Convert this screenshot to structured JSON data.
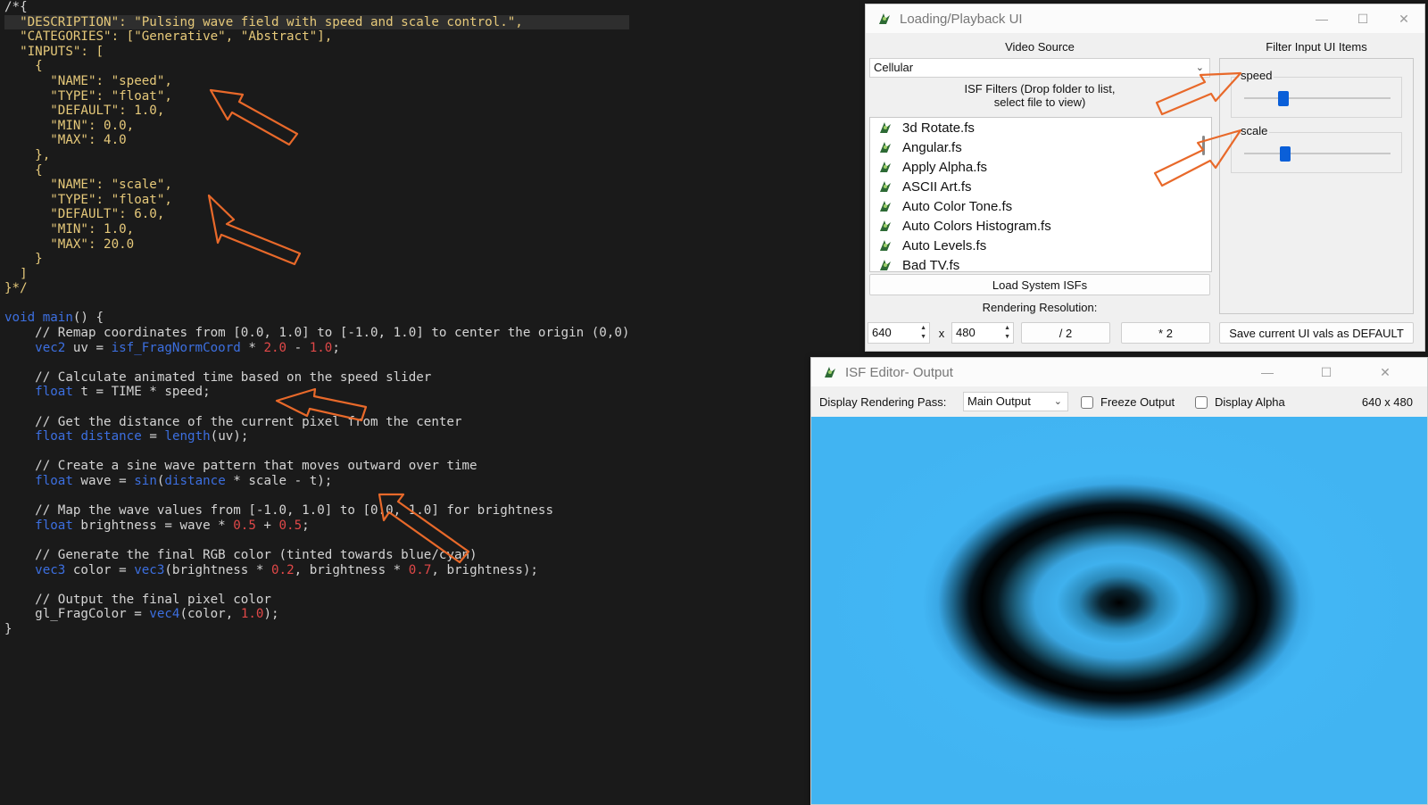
{
  "editor": {
    "lines": [
      [
        {
          "t": "/*{",
          "c": "c-txt"
        }
      ],
      [
        {
          "t": "  \"DESCRIPTION\": \"Pulsing wave field with speed and scale control.\",",
          "c": "c-meta"
        }
      ],
      [
        {
          "t": "  \"CATEGORIES\": [\"Generative\", \"Abstract\"],",
          "c": "c-meta"
        }
      ],
      [
        {
          "t": "  \"INPUTS\": [",
          "c": "c-meta"
        }
      ],
      [
        {
          "t": "    {",
          "c": "c-meta"
        }
      ],
      [
        {
          "t": "      \"NAME\": \"speed\",",
          "c": "c-meta"
        }
      ],
      [
        {
          "t": "      \"TYPE\": \"float\",",
          "c": "c-meta"
        }
      ],
      [
        {
          "t": "      \"DEFAULT\": 1.0,",
          "c": "c-meta"
        }
      ],
      [
        {
          "t": "      \"MIN\": 0.0,",
          "c": "c-meta"
        }
      ],
      [
        {
          "t": "      \"MAX\": 4.0",
          "c": "c-meta"
        }
      ],
      [
        {
          "t": "    },",
          "c": "c-meta"
        }
      ],
      [
        {
          "t": "    {",
          "c": "c-meta"
        }
      ],
      [
        {
          "t": "      \"NAME\": \"scale\",",
          "c": "c-meta"
        }
      ],
      [
        {
          "t": "      \"TYPE\": \"float\",",
          "c": "c-meta"
        }
      ],
      [
        {
          "t": "      \"DEFAULT\": 6.0,",
          "c": "c-meta"
        }
      ],
      [
        {
          "t": "      \"MIN\": 1.0,",
          "c": "c-meta"
        }
      ],
      [
        {
          "t": "      \"MAX\": 20.0",
          "c": "c-meta"
        }
      ],
      [
        {
          "t": "    }",
          "c": "c-meta"
        }
      ],
      [
        {
          "t": "  ]",
          "c": "c-meta"
        }
      ],
      [
        {
          "t": "}*/",
          "c": "c-meta"
        }
      ],
      [
        {
          "t": "",
          "c": "c-txt"
        }
      ],
      [
        {
          "t": "void",
          "c": "c-kw"
        },
        {
          "t": " ",
          "c": "c-txt"
        },
        {
          "t": "main",
          "c": "c-fn"
        },
        {
          "t": "() {",
          "c": "c-txt"
        }
      ],
      [
        {
          "t": "    // Remap coordinates from [0.0, 1.0] to [-1.0, 1.0] to center the origin (0,0)",
          "c": "c-com"
        }
      ],
      [
        {
          "t": "    ",
          "c": "c-txt"
        },
        {
          "t": "vec2",
          "c": "c-kw"
        },
        {
          "t": " uv = ",
          "c": "c-txt"
        },
        {
          "t": "isf_FragNormCoord",
          "c": "c-fn"
        },
        {
          "t": " * ",
          "c": "c-txt"
        },
        {
          "t": "2.0",
          "c": "c-num"
        },
        {
          "t": " - ",
          "c": "c-txt"
        },
        {
          "t": "1.0",
          "c": "c-num"
        },
        {
          "t": ";",
          "c": "c-txt"
        }
      ],
      [
        {
          "t": "",
          "c": "c-txt"
        }
      ],
      [
        {
          "t": "    // Calculate animated time based on the speed slider",
          "c": "c-com"
        }
      ],
      [
        {
          "t": "    ",
          "c": "c-txt"
        },
        {
          "t": "float",
          "c": "c-kw"
        },
        {
          "t": " t = TIME * speed;",
          "c": "c-txt"
        }
      ],
      [
        {
          "t": "",
          "c": "c-txt"
        }
      ],
      [
        {
          "t": "    // Get the distance of the current pixel from the center",
          "c": "c-com"
        }
      ],
      [
        {
          "t": "    ",
          "c": "c-txt"
        },
        {
          "t": "float",
          "c": "c-kw"
        },
        {
          "t": " ",
          "c": "c-txt"
        },
        {
          "t": "distance",
          "c": "c-fn"
        },
        {
          "t": " = ",
          "c": "c-txt"
        },
        {
          "t": "length",
          "c": "c-fn"
        },
        {
          "t": "(uv);",
          "c": "c-txt"
        }
      ],
      [
        {
          "t": "",
          "c": "c-txt"
        }
      ],
      [
        {
          "t": "    // Create a sine wave pattern that moves outward over time",
          "c": "c-com"
        }
      ],
      [
        {
          "t": "    ",
          "c": "c-txt"
        },
        {
          "t": "float",
          "c": "c-kw"
        },
        {
          "t": " wave = ",
          "c": "c-txt"
        },
        {
          "t": "sin",
          "c": "c-fn"
        },
        {
          "t": "(",
          "c": "c-txt"
        },
        {
          "t": "distance",
          "c": "c-fn"
        },
        {
          "t": " * scale - t);",
          "c": "c-txt"
        }
      ],
      [
        {
          "t": "",
          "c": "c-txt"
        }
      ],
      [
        {
          "t": "    // Map the wave values from [-1.0, 1.0] to [0.0, 1.0] for brightness",
          "c": "c-com"
        }
      ],
      [
        {
          "t": "    ",
          "c": "c-txt"
        },
        {
          "t": "float",
          "c": "c-kw"
        },
        {
          "t": " brightness = wave * ",
          "c": "c-txt"
        },
        {
          "t": "0.5",
          "c": "c-num"
        },
        {
          "t": " + ",
          "c": "c-txt"
        },
        {
          "t": "0.5",
          "c": "c-num"
        },
        {
          "t": ";",
          "c": "c-txt"
        }
      ],
      [
        {
          "t": "",
          "c": "c-txt"
        }
      ],
      [
        {
          "t": "    // Generate the final RGB color (tinted towards blue/cyan)",
          "c": "c-com"
        }
      ],
      [
        {
          "t": "    ",
          "c": "c-txt"
        },
        {
          "t": "vec3",
          "c": "c-kw"
        },
        {
          "t": " color = ",
          "c": "c-txt"
        },
        {
          "t": "vec3",
          "c": "c-fn"
        },
        {
          "t": "(brightness * ",
          "c": "c-txt"
        },
        {
          "t": "0.2",
          "c": "c-num"
        },
        {
          "t": ", brightness * ",
          "c": "c-txt"
        },
        {
          "t": "0.7",
          "c": "c-num"
        },
        {
          "t": ", brightness);",
          "c": "c-txt"
        }
      ],
      [
        {
          "t": "",
          "c": "c-txt"
        }
      ],
      [
        {
          "t": "    // Output the final pixel color",
          "c": "c-com"
        }
      ],
      [
        {
          "t": "    gl_FragColor = ",
          "c": "c-txt"
        },
        {
          "t": "vec4",
          "c": "c-fn"
        },
        {
          "t": "(color, ",
          "c": "c-txt"
        },
        {
          "t": "1.0",
          "c": "c-num"
        },
        {
          "t": ");",
          "c": "c-txt"
        }
      ],
      [
        {
          "t": "}",
          "c": "c-txt"
        }
      ]
    ]
  },
  "loading_window": {
    "title": "Loading/Playback UI",
    "video_source_label": "Video Source",
    "video_source_value": "Cellular",
    "isf_filters_label": "ISF Filters (Drop folder to list,\nselect file to view)",
    "files": [
      "3d Rotate.fs",
      "Angular.fs",
      "Apply Alpha.fs",
      "ASCII Art.fs",
      "Auto Color Tone.fs",
      "Auto Colors Histogram.fs",
      "Auto Levels.fs",
      "Bad TV.fs"
    ],
    "load_system_button": "Load System ISFs",
    "rendering_resolution_label": "Rendering Resolution:",
    "res_width": "640",
    "res_x": "x",
    "res_height": "480",
    "half_button": "/ 2",
    "double_button": "* 2",
    "filter_input_label": "Filter Input UI Items",
    "speed_label": "speed",
    "speed_level": 0.27,
    "scale_label": "scale",
    "scale_level": 0.28,
    "save_default_button": "Save current UI vals as DEFAULT"
  },
  "output_window": {
    "title": "ISF Editor- Output",
    "display_pass_label": "Display Rendering Pass:",
    "display_pass_value": "Main Output",
    "freeze_label": "Freeze Output",
    "display_alpha_label": "Display Alpha",
    "size_readout": "640 x 480"
  },
  "colors": {
    "annotation_arrow": "#e8692a",
    "slider_handle": "#0a5fd8",
    "render_cyan": "#41b4f2"
  }
}
